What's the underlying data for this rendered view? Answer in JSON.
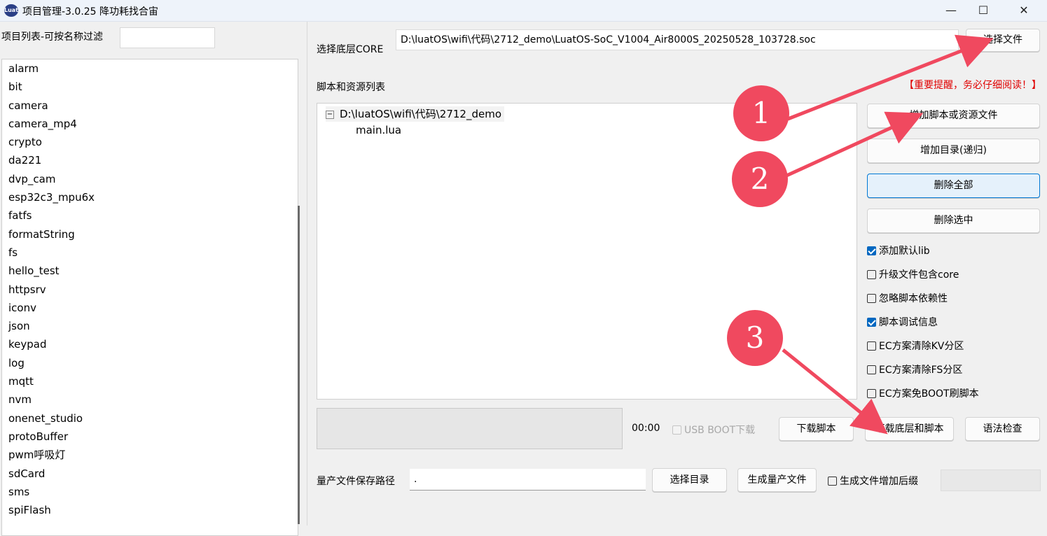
{
  "window": {
    "title": "项目管理-3.0.25 降功耗找合宙",
    "logo_icon": "luat-logo",
    "minimize": "—",
    "maximize": "☐",
    "close": "✕"
  },
  "left": {
    "filter_label": "项目列表-可按名称过滤",
    "filter_value": "",
    "projects": [
      "alarm",
      "bit",
      "camera",
      "camera_mp4",
      "crypto",
      "da221",
      "dvp_cam",
      "esp32c3_mpu6x",
      "fatfs",
      "formatString",
      "fs",
      "hello_test",
      "httpsrv",
      "iconv",
      "json",
      "keypad",
      "log",
      "mqtt",
      "nvm",
      "onenet_studio",
      "protoBuffer",
      "pwm呼吸灯",
      "sdCard",
      "sms",
      "spiFlash"
    ]
  },
  "core": {
    "label": "选择底层CORE",
    "path": "D:\\luatOS\\wifi\\代码\\2712_demo\\LuatOS-SoC_V1004_Air8000S_20250528_103728.soc",
    "select_button": "选择文件"
  },
  "scripts": {
    "label": "脚本和资源列表",
    "warning": "【重要提醒，务必仔细阅读！】",
    "tree_toggle": "−",
    "tree_root": "D:\\luatOS\\wifi\\代码\\2712_demo",
    "tree_child": "main.lua",
    "buttons": {
      "add_script": "增加脚本或资源文件",
      "add_dir": "增加目录(递归)",
      "delete_all": "删除全部",
      "delete_selected": "删除选中"
    },
    "options": [
      {
        "label": "添加默认lib",
        "checked": true
      },
      {
        "label": "升级文件包含core",
        "checked": false
      },
      {
        "label": "忽略脚本依赖性",
        "checked": false
      },
      {
        "label": "脚本调试信息",
        "checked": true
      },
      {
        "label": "EC方案清除KV分区",
        "checked": false
      },
      {
        "label": "EC方案清除FS分区",
        "checked": false
      },
      {
        "label": "EC方案免BOOT刷脚本",
        "checked": false
      }
    ]
  },
  "download": {
    "timer": "00:00",
    "usb_boot": "USB BOOT下载",
    "download_script": "下载脚本",
    "download_core_script": "下载底层和脚本",
    "syntax_check": "语法检查"
  },
  "mass": {
    "label": "量产文件保存路径",
    "path": ".",
    "select_dir": "选择目录",
    "generate": "生成量产文件",
    "suffix_option": "生成文件增加后缀"
  },
  "annotations": {
    "one": "1",
    "two": "2",
    "three": "3",
    "color": "#f0495f"
  }
}
